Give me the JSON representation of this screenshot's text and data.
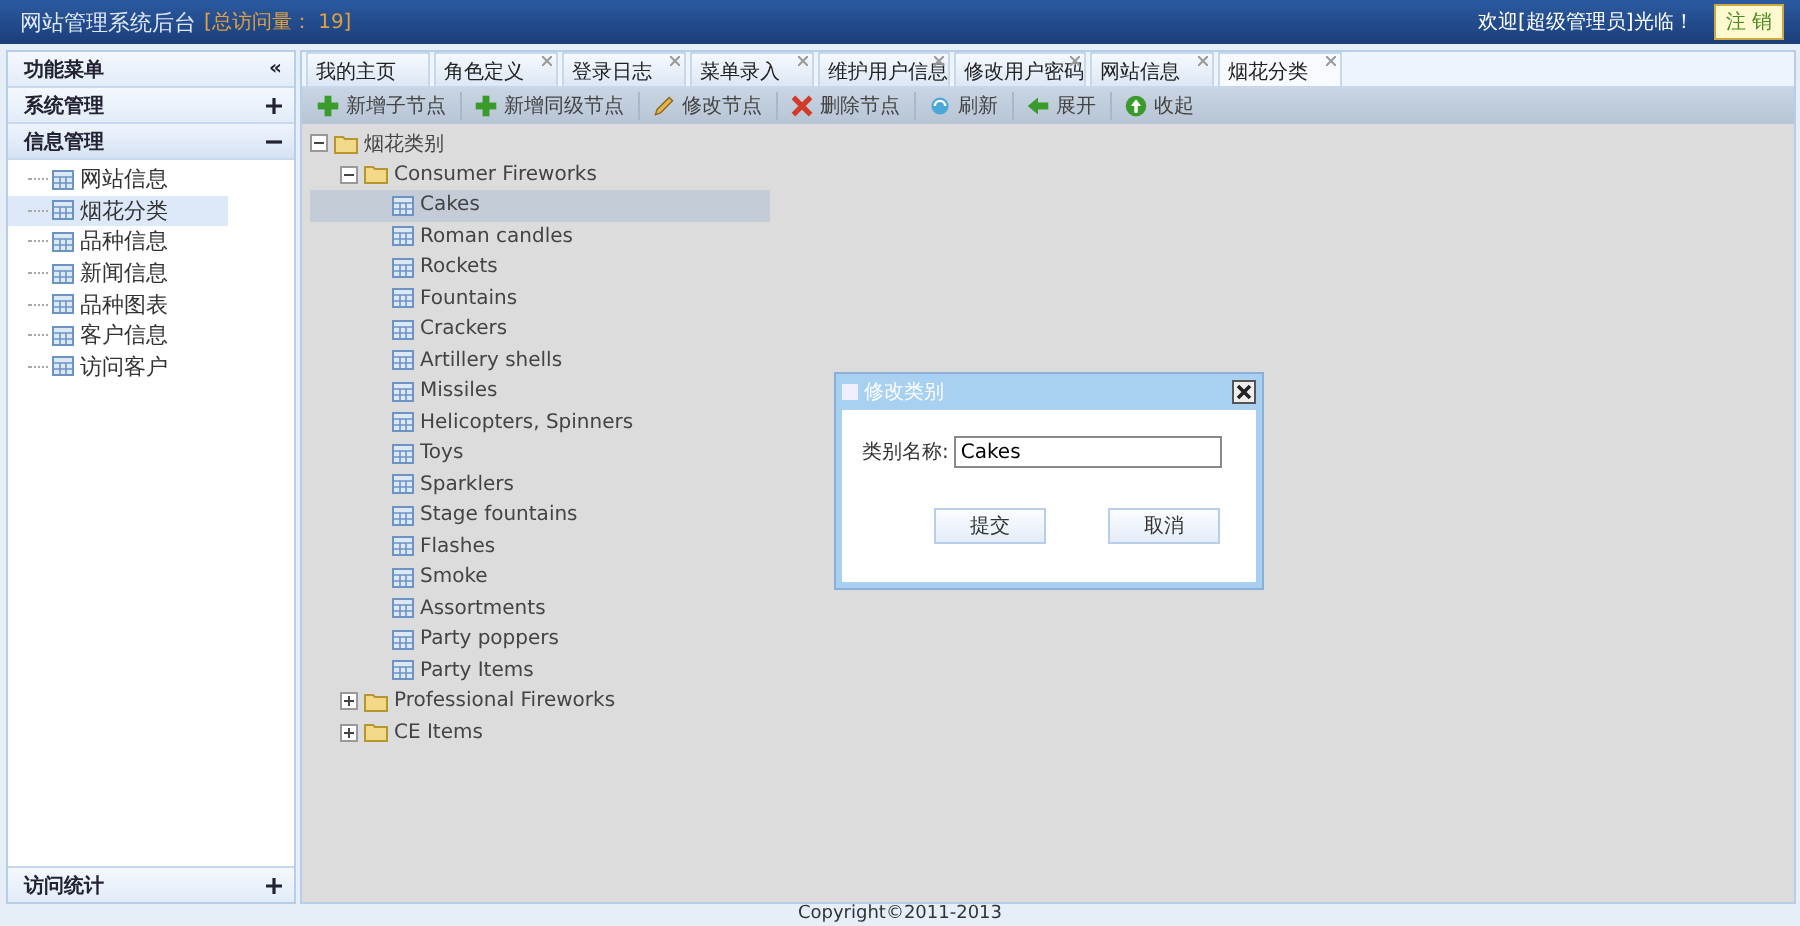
{
  "header": {
    "title": "网站管理系统后台",
    "visits": "[总访问量： 19]",
    "welcome": "欢迎[超级管理员]光临！",
    "logout": "注 销"
  },
  "sidebar": {
    "title": "功能菜单",
    "collapse": "«",
    "sections": [
      {
        "label": "系统管理",
        "expanded": false
      },
      {
        "label": "信息管理",
        "expanded": true,
        "items": [
          {
            "label": "网站信息",
            "selected": false
          },
          {
            "label": "烟花分类",
            "selected": true
          },
          {
            "label": "品种信息",
            "selected": false
          },
          {
            "label": "新闻信息",
            "selected": false
          },
          {
            "label": "品种图表",
            "selected": false
          },
          {
            "label": "客户信息",
            "selected": false
          },
          {
            "label": "访问客户",
            "selected": false
          }
        ]
      }
    ],
    "bottom_section": {
      "label": "访问统计",
      "expanded": false
    }
  },
  "tabs": [
    {
      "label": "我的主页",
      "closable": false,
      "selected": false
    },
    {
      "label": "角色定义",
      "closable": true,
      "selected": false
    },
    {
      "label": "登录日志",
      "closable": true,
      "selected": false
    },
    {
      "label": "菜单录入",
      "closable": true,
      "selected": false
    },
    {
      "label": "维护用户信息",
      "closable": true,
      "selected": false
    },
    {
      "label": "修改用户密码",
      "closable": true,
      "selected": false
    },
    {
      "label": "网站信息",
      "closable": true,
      "selected": false
    },
    {
      "label": "烟花分类",
      "closable": true,
      "selected": true
    }
  ],
  "toolbar": [
    {
      "label": "新增子节点"
    },
    {
      "label": "新增同级节点"
    },
    {
      "label": "修改节点"
    },
    {
      "label": "删除节点"
    },
    {
      "label": "刷新"
    },
    {
      "label": "展开"
    },
    {
      "label": "收起"
    }
  ],
  "tree": [
    {
      "label": "烟花类别",
      "kind": "folder",
      "expanded": true,
      "selected": false,
      "children": [
        {
          "label": "Consumer Fireworks",
          "kind": "folder",
          "expanded": true,
          "selected": false,
          "children": [
            {
              "label": "Cakes",
              "kind": "item",
              "selected": true
            },
            {
              "label": "Roman candles",
              "kind": "item",
              "selected": false
            },
            {
              "label": "Rockets",
              "kind": "item",
              "selected": false
            },
            {
              "label": "Fountains",
              "kind": "item",
              "selected": false
            },
            {
              "label": "Crackers",
              "kind": "item",
              "selected": false
            },
            {
              "label": "Artillery shells",
              "kind": "item",
              "selected": false
            },
            {
              "label": "Missiles",
              "kind": "item",
              "selected": false
            },
            {
              "label": "Helicopters, Spinners",
              "kind": "item",
              "selected": false
            },
            {
              "label": "Toys",
              "kind": "item",
              "selected": false
            },
            {
              "label": "Sparklers",
              "kind": "item",
              "selected": false
            },
            {
              "label": "Stage fountains",
              "kind": "item",
              "selected": false
            },
            {
              "label": "Flashes",
              "kind": "item",
              "selected": false
            },
            {
              "label": "Smoke",
              "kind": "item",
              "selected": false
            },
            {
              "label": "Assortments",
              "kind": "item",
              "selected": false
            },
            {
              "label": "Party poppers",
              "kind": "item",
              "selected": false
            },
            {
              "label": "Party Items",
              "kind": "item",
              "selected": false
            }
          ]
        },
        {
          "label": "Professional Fireworks",
          "kind": "folder",
          "expanded": false,
          "selected": false
        },
        {
          "label": "CE Items",
          "kind": "folder",
          "expanded": false,
          "selected": false
        }
      ]
    }
  ],
  "dialog": {
    "title": "修改类别",
    "field_label": "类别名称:",
    "field_value": "Cakes",
    "buttons": [
      "提交",
      "取消"
    ]
  },
  "footer": "Copyright©2011-2013"
}
